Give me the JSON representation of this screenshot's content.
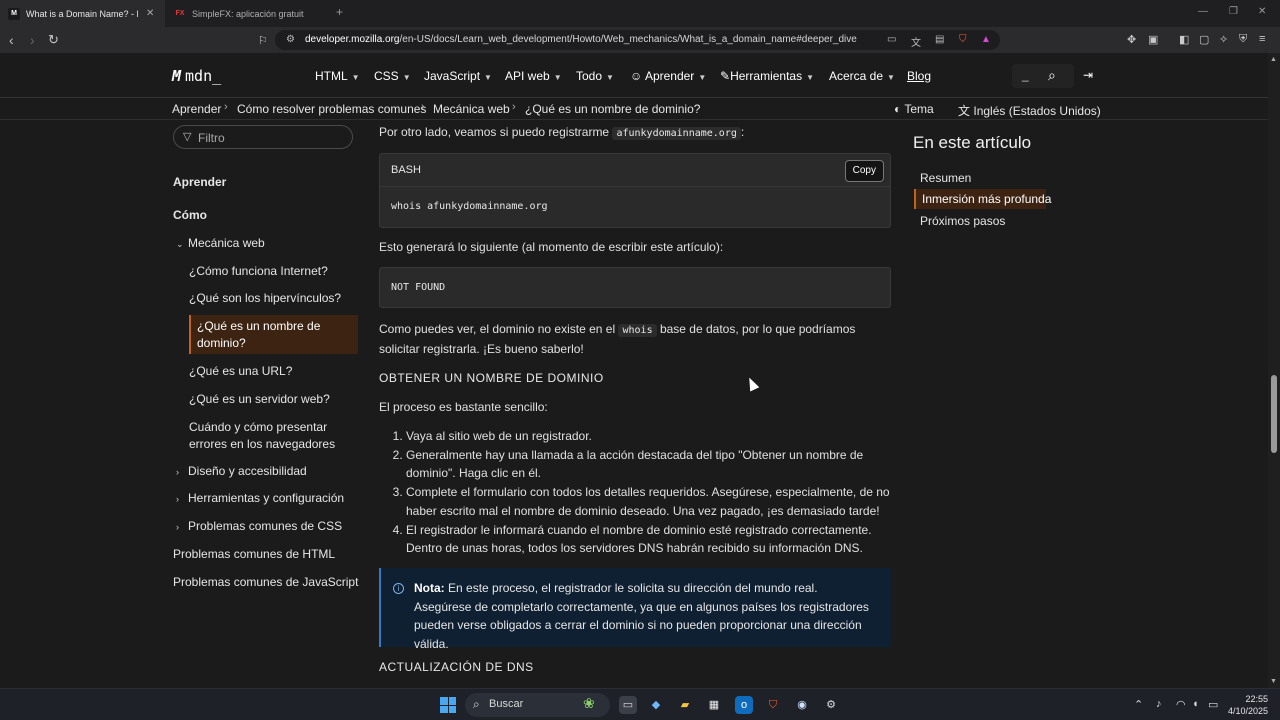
{
  "browser": {
    "tabs": [
      {
        "title": "What is a Domain Name? - Learn",
        "favicon": "M",
        "active": true
      },
      {
        "title": "SimpleFX: aplicación gratuita de com",
        "favicon": "FX",
        "active": false
      }
    ],
    "new_tab": "+",
    "window_controls": {
      "minimize": "—",
      "restore": "❐",
      "close": "✕"
    },
    "url": {
      "host": "developer.mozilla.org",
      "path": "/en-US/docs/Learn_web_development/Howto/Web_mechanics/What_is_a_domain_name#deeper_dive"
    }
  },
  "mdn": {
    "logo": {
      "mark": "M",
      "text": "mdn_"
    },
    "nav": [
      {
        "label": "HTML"
      },
      {
        "label": "CSS"
      },
      {
        "label": "JavaScript"
      },
      {
        "label": "API web"
      },
      {
        "label": "Todo"
      },
      {
        "label": "Aprender"
      },
      {
        "label": "Herramientas"
      },
      {
        "label": "Acerca de"
      }
    ],
    "blog": "Blog",
    "search_placeholder": "_"
  },
  "breadcrumb": {
    "items": [
      "Aprender",
      "Cómo resolver problemas comunes",
      "Mecánica web",
      "¿Qué es un nombre de dominio?"
    ],
    "theme": "Tema",
    "language": "Inglés (Estados Unidos)"
  },
  "sidebar": {
    "filter_placeholder": "Filtro",
    "items": [
      {
        "label": "Aprender"
      },
      {
        "label": "Cómo"
      },
      {
        "label": "Mecánica web"
      },
      {
        "label": "¿Cómo funciona Internet?"
      },
      {
        "label": "¿Qué son los hipervínculos?"
      },
      {
        "label": "¿Qué es un nombre de dominio?"
      },
      {
        "label": "¿Qué es una URL?"
      },
      {
        "label": "¿Qué es un servidor web?"
      },
      {
        "label": "Cuándo y cómo presentar errores en los navegadores"
      },
      {
        "label": "Diseño y accesibilidad"
      },
      {
        "label": "Herramientas y configuración"
      },
      {
        "label": "Problemas comunes de CSS"
      },
      {
        "label": "Problemas comunes de HTML"
      },
      {
        "label": "Problemas comunes de JavaScript"
      }
    ]
  },
  "article": {
    "intro_prefix": "Por otro lado, veamos si puedo registrarme",
    "intro_code": "afunkydomainname.org",
    "intro_suffix": ":",
    "code1": {
      "lang": "BASH",
      "copy": "Copy",
      "content": "whois afunkydomainname.org"
    },
    "result_intro": "Esto generará lo siguiente (al momento de escribir este artículo):",
    "code2": {
      "content": "NOT FOUND"
    },
    "explain_prefix": "Como puedes ver, el dominio no existe en el",
    "explain_code": "whois",
    "explain_suffix": "base de datos, por lo que podríamos solicitar registrarla. ¡Es bueno saberlo!",
    "h_obtain": "OBTENER UN NOMBRE DE DOMINIO",
    "process": "El proceso es bastante sencillo:",
    "steps": [
      "Vaya al sitio web de un registrador.",
      "Generalmente hay una llamada a la acción destacada del tipo \"Obtener un nombre de dominio\". Haga clic en él.",
      "Complete el formulario con todos los detalles requeridos. Asegúrese, especialmente, de no haber escrito mal el nombre de dominio deseado. Una vez pagado, ¡es demasiado tarde!",
      "El registrador le informará cuando el nombre de dominio esté registrado correctamente. Dentro de unas horas, todos los servidores DNS habrán recibido su información DNS."
    ],
    "note_label": "Nota:",
    "note_text": "En este proceso, el registrador le solicita su dirección del mundo real. Asegúrese de completarlo correctamente, ya que en algunos países los registradores pueden verse obligados a cerrar el dominio si no pueden proporcionar una dirección válida.",
    "h_dns": "ACTUALIZACIÓN DE DNS"
  },
  "toc": {
    "title": "En este artículo",
    "items": [
      "Resumen",
      "Inmersión más profunda",
      "Próximos pasos"
    ]
  },
  "taskbar": {
    "search": "Buscar",
    "time": "22:55",
    "date": "4/10/2025"
  }
}
